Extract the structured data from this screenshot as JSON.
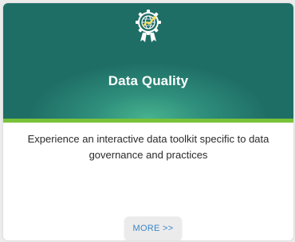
{
  "card": {
    "icon": "data-quality-badge-icon",
    "title": "Data Quality",
    "description": "Experience an interactive  data toolkit specific to data governance and practices",
    "more_label": "MORE >>"
  },
  "colors": {
    "header_dark": "#1f6e66",
    "header_light": "#48b38e",
    "accent_bar": "#79c23a",
    "button_text": "#3a86c8"
  }
}
